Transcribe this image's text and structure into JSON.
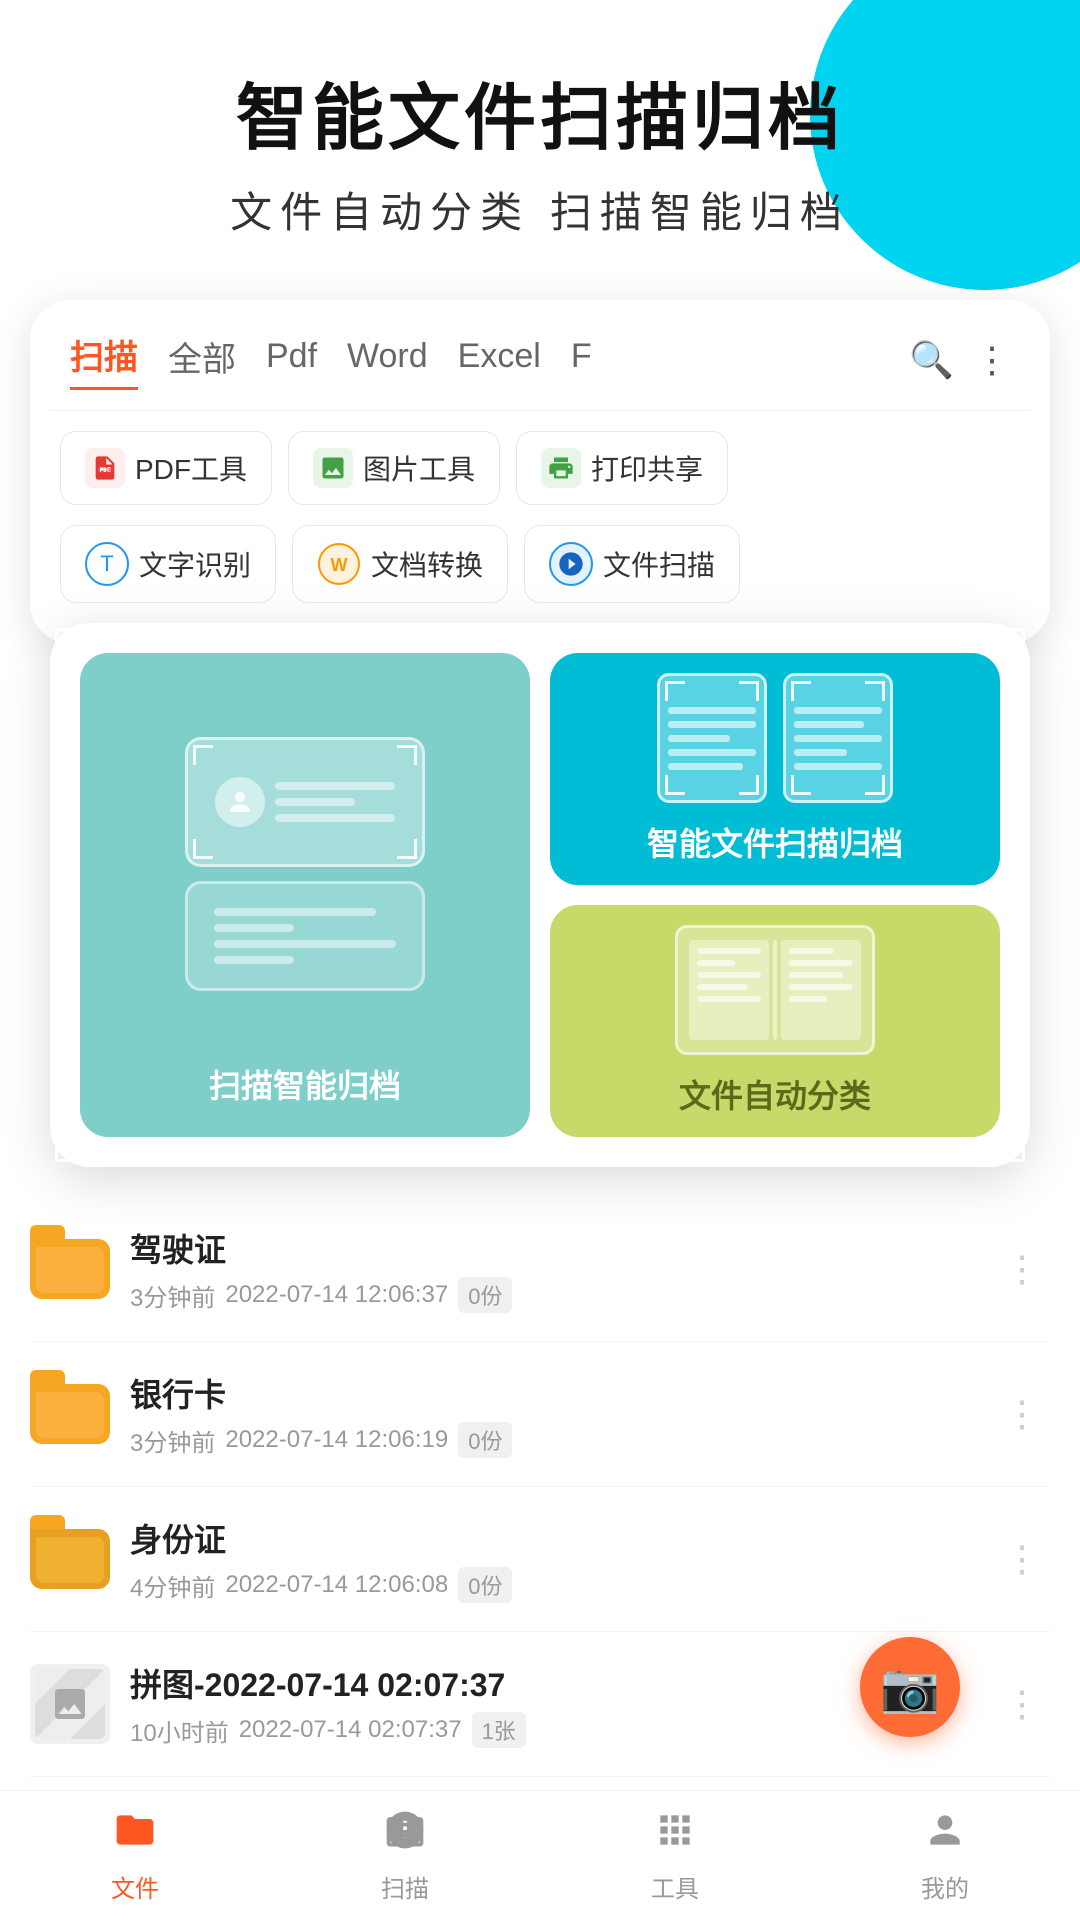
{
  "app": {
    "title": "智能文件扫描归档",
    "subtitle": "文件自动分类   扫描智能归档"
  },
  "tabs": {
    "items": [
      {
        "label": "扫描",
        "active": true
      },
      {
        "label": "全部",
        "active": false
      },
      {
        "label": "Pdf",
        "active": false
      },
      {
        "label": "Word",
        "active": false
      },
      {
        "label": "Excel",
        "active": false
      },
      {
        "label": "F",
        "active": false
      }
    ]
  },
  "tools": [
    {
      "icon": "pdf",
      "label": "PDF工具"
    },
    {
      "icon": "img",
      "label": "图片工具"
    },
    {
      "icon": "print",
      "label": "打印共享"
    }
  ],
  "ocr_tools": [
    {
      "label": "文字识别"
    },
    {
      "label": "文档转换"
    },
    {
      "label": "文件扫描"
    }
  ],
  "features": {
    "left": {
      "label": "扫描智能归档"
    },
    "right_top": {
      "label": "智能文件扫描归档"
    },
    "right_bottom": {
      "label": "文件自动分类"
    }
  },
  "files": [
    {
      "name": "驾驶证",
      "time": "3分钟前",
      "date": "2022-07-14 12:06:37",
      "count": "0份",
      "type": "folder"
    },
    {
      "name": "银行卡",
      "time": "3分钟前",
      "date": "2022-07-14 12:06:19",
      "count": "0份",
      "type": "folder"
    },
    {
      "name": "身份证",
      "time": "4分钟前",
      "date": "2022-07-14 12:06:08",
      "count": "0份",
      "type": "folder"
    },
    {
      "name": "拼图-2022-07-14 02:07:37",
      "time": "10小时前",
      "date": "2022-07-14 02:07:37",
      "count": "1张",
      "type": "image"
    }
  ],
  "nav": {
    "items": [
      {
        "icon": "📁",
        "label": "文件",
        "active": true
      },
      {
        "icon": "📷",
        "label": "扫描",
        "active": false
      },
      {
        "icon": "🔲",
        "label": "工具",
        "active": false
      },
      {
        "icon": "👤",
        "label": "我的",
        "active": false
      }
    ]
  },
  "more_icon": "⋮",
  "search_icon": "🔍",
  "camera_icon": "📷"
}
